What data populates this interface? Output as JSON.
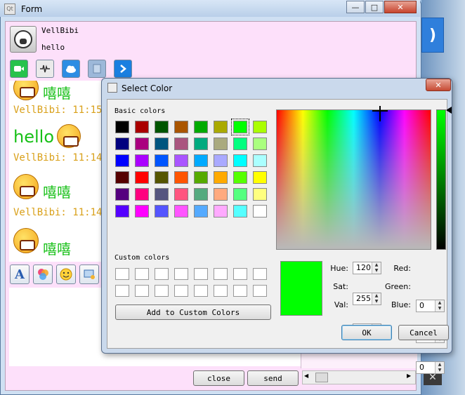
{
  "main_window": {
    "title": "Form",
    "minimize": "—",
    "maximize": "□",
    "close": "✕"
  },
  "profile": {
    "username": "VellBibi",
    "signature": "hello"
  },
  "toolbar": {
    "icons": [
      "video-icon",
      "audio-wave-icon",
      "cloud-icon",
      "file-icon",
      "arrow-right-icon"
    ]
  },
  "chat": {
    "messages": [
      {
        "emote": "嘻嘻",
        "meta": "VellBibi: 11:15"
      },
      {
        "text": "hello",
        "meta": "VellBibi: 11:14"
      },
      {
        "emote": "嘻嘻",
        "meta": "VellBibi: 11:14"
      },
      {
        "emote": "嘻嘻"
      }
    ]
  },
  "format_bar": {
    "font_glyph": "A"
  },
  "buttons": {
    "close": "close",
    "send": "send"
  },
  "color_dialog": {
    "title": "Select Color",
    "close": "✕",
    "basic_colors_label": "Basic colors",
    "basic_colors": [
      [
        "#000000",
        "#aa0000",
        "#005500",
        "#aa5500",
        "#00aa00",
        "#aaaa00",
        "#00ff00",
        "#aaff00"
      ],
      [
        "#00007f",
        "#aa007f",
        "#00557f",
        "#aa557f",
        "#00aa7f",
        "#aaaa7f",
        "#00ff7f",
        "#aaff7f"
      ],
      [
        "#0000ff",
        "#aa00ff",
        "#0055ff",
        "#aa55ff",
        "#00aaff",
        "#aaaaff",
        "#00ffff",
        "#aaffff"
      ],
      [
        "#550000",
        "#ff0000",
        "#555500",
        "#ff5500",
        "#55aa00",
        "#ffaa00",
        "#55ff00",
        "#ffff00"
      ],
      [
        "#55007f",
        "#ff007f",
        "#55557f",
        "#ff557f",
        "#55aa7f",
        "#ffaa7f",
        "#55ff7f",
        "#ffff7f"
      ],
      [
        "#5500ff",
        "#ff00ff",
        "#5555ff",
        "#ff55ff",
        "#55aaff",
        "#ffaaff",
        "#55ffff",
        "#ffffff"
      ]
    ],
    "selected_basic_index": [
      0,
      6
    ],
    "custom_colors_label": "Custom colors",
    "add_custom_label": "Add to Custom Colors",
    "current_color": "#00ff00",
    "fields": {
      "hue_label": "Hue:",
      "hue": "120",
      "sat_label": "Sat:",
      "sat": "255",
      "val_label": "Val:",
      "val": "255",
      "red_label": "Red:",
      "red": "0",
      "green_label": "Green:",
      "green": "255",
      "blue_label": "Blue:",
      "blue": "0"
    },
    "ok_label": "OK",
    "cancel_label": "Cancel"
  }
}
